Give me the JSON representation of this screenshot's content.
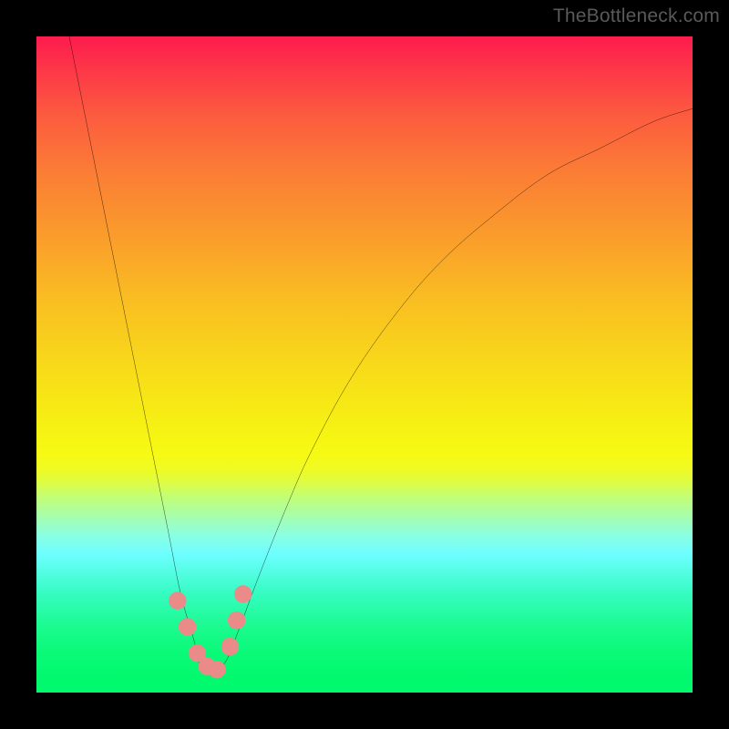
{
  "watermark": "TheBottleneck.com",
  "colors": {
    "frame": "#000000",
    "curve": "#000000",
    "marker": "#ea8b89",
    "gradient_css": "linear-gradient(to bottom, #fd1c4e 0%, #fd3149 4%, #fc5b3f 12%, #fb7e35 21%, #fa9e2b 31%, #f9bd22 40%, #f8d91a 50%, #f6f013 59%, #f6f812 62.5%, #f6fa15 64%, #eefb24 66%, #ddfc44 68%, #c4fe72 70%, #a8feaa 73%, #8bffe2 76%, #6cfeff 79%, #35fcc0 85%, #1bfb8f 90%, #0afa78 94%, #01f96e 98%, #00f96d 100%)"
  },
  "chart_data": {
    "type": "line",
    "title": "",
    "xlabel": "",
    "ylabel": "",
    "xlim": [
      0,
      100
    ],
    "ylim": [
      0,
      100
    ],
    "grid": false,
    "legend": false,
    "annotations": [
      "valley-shaped curve with minimum near x≈26; steep left arm, shallower right arm"
    ],
    "series": [
      {
        "name": "curve",
        "x": [
          5,
          8,
          11,
          14,
          17,
          20,
          22,
          24,
          25,
          27,
          29,
          31,
          34,
          38,
          42,
          48,
          55,
          62,
          70,
          78,
          86,
          94,
          100
        ],
        "y": [
          100,
          85,
          70,
          55,
          40,
          25,
          15,
          8,
          4,
          3,
          5,
          10,
          18,
          28,
          37,
          48,
          58,
          66,
          73,
          79,
          83,
          87,
          89
        ]
      }
    ],
    "markers": {
      "name": "highlight-points",
      "x": [
        21.5,
        23,
        24.5,
        26,
        27.5,
        29.5,
        30.5,
        31.5
      ],
      "y": [
        14,
        10,
        6,
        4,
        3.5,
        7,
        11,
        15
      ]
    }
  }
}
